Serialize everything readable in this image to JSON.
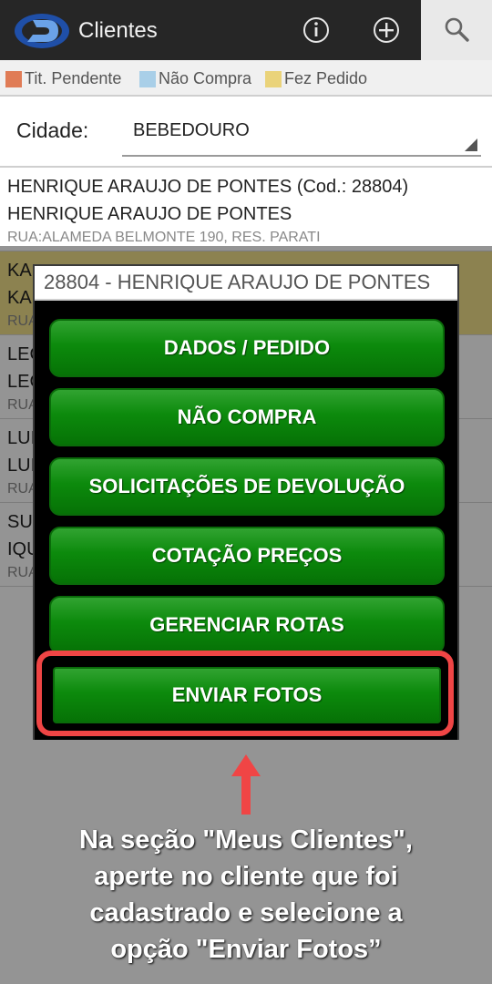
{
  "app": {
    "title": "Clientes"
  },
  "legend": [
    {
      "label": "Tit. Pendente",
      "color": "#e07c56"
    },
    {
      "label": "Não Compra",
      "color": "#a9cfe8"
    },
    {
      "label": "Fez Pedido",
      "color": "#ead37a"
    }
  ],
  "city_filter": {
    "label": "Cidade:",
    "value": "BEBEDOURO"
  },
  "clients": [
    {
      "line1": "HENRIQUE ARAUJO DE PONTES (Cod.: 28804)",
      "line2": "HENRIQUE ARAUJO DE PONTES",
      "address": "RUA:ALAMEDA BELMONTE 190, RES. PARATI",
      "status": "none"
    },
    {
      "line1": "KA",
      "line2": "KA",
      "address": "RUA",
      "status": "Fez Pedido"
    },
    {
      "line1": "LEC",
      "line2": "LEC",
      "address": "RUA",
      "status": "none"
    },
    {
      "line1": "LUI",
      "line2": "LUI",
      "address": "RUA",
      "status": "none"
    },
    {
      "line1": "SU",
      "line2": "IQU",
      "address": "RUA",
      "status": "none"
    }
  ],
  "dialog": {
    "title": "28804 - HENRIQUE ARAUJO DE PONTES",
    "buttons": [
      "DADOS / PEDIDO",
      "NÃO COMPRA",
      "SOLICITAÇÕES DE DEVOLUÇÃO",
      "COTAÇÃO PREÇOS",
      "GERENCIAR ROTAS",
      "ENVIAR FOTOS"
    ]
  },
  "annotation": {
    "highlight_color": "#f04545",
    "caption_lines": [
      "Na seção \"Meus Clientes\",",
      "aperte no cliente que foi",
      "cadastrado e selecione a",
      "opção \"Enviar Fotos”"
    ]
  },
  "icons": [
    "app-logo-icon",
    "info-icon",
    "add-icon",
    "search-icon",
    "dropdown-caret-icon",
    "up-arrow-icon"
  ]
}
